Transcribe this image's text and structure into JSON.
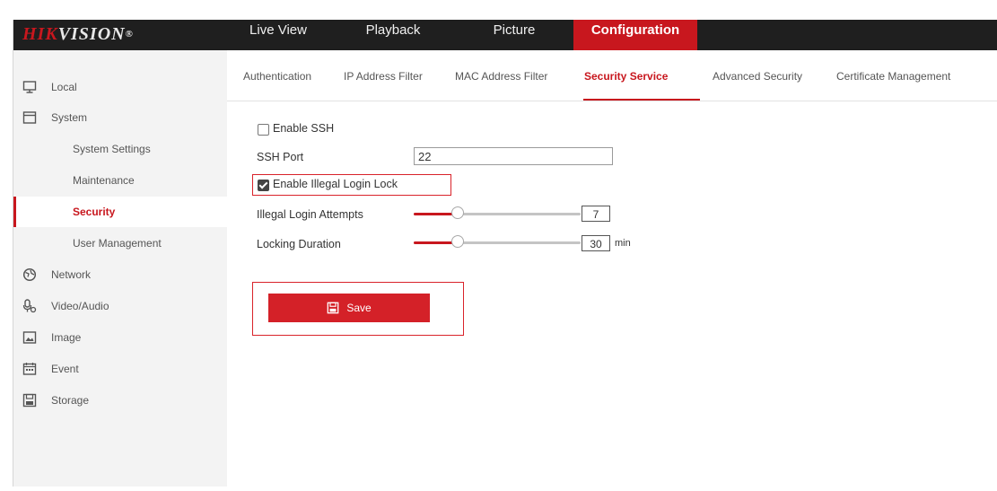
{
  "header": {
    "logo_red": "HIK",
    "logo_rest": "VISION",
    "logo_mark": "®",
    "nav": [
      {
        "label": "Live View",
        "active": false
      },
      {
        "label": "Playback",
        "active": false
      },
      {
        "label": "Picture",
        "active": false
      },
      {
        "label": "Configuration",
        "active": true
      }
    ]
  },
  "sidebar": {
    "items": [
      {
        "label": "Local",
        "icon": "monitor-icon",
        "sub": false,
        "active": false
      },
      {
        "label": "System",
        "icon": "system-icon",
        "sub": false,
        "active": false
      },
      {
        "label": "System Settings",
        "sub": true,
        "active": false
      },
      {
        "label": "Maintenance",
        "sub": true,
        "active": false
      },
      {
        "label": "Security",
        "sub": true,
        "active": true
      },
      {
        "label": "User Management",
        "sub": true,
        "active": false
      },
      {
        "label": "Network",
        "icon": "network-icon",
        "sub": false,
        "active": false
      },
      {
        "label": "Video/Audio",
        "icon": "microphone-icon",
        "sub": false,
        "active": false
      },
      {
        "label": "Image",
        "icon": "image-icon",
        "sub": false,
        "active": false
      },
      {
        "label": "Event",
        "icon": "calendar-icon",
        "sub": false,
        "active": false
      },
      {
        "label": "Storage",
        "icon": "storage-icon",
        "sub": false,
        "active": false
      }
    ]
  },
  "tabs": [
    {
      "label": "Authentication",
      "active": false
    },
    {
      "label": "IP Address Filter",
      "active": false
    },
    {
      "label": "MAC Address Filter",
      "active": false
    },
    {
      "label": "Security Service",
      "active": true
    },
    {
      "label": "Advanced Security",
      "active": false
    },
    {
      "label": "Certificate Management",
      "active": false
    }
  ],
  "form": {
    "enable_ssh_label": "Enable SSH",
    "enable_ssh_checked": false,
    "ssh_port_label": "SSH Port",
    "ssh_port_value": "22",
    "illegal_login_lock_label": "Enable Illegal Login Lock",
    "illegal_login_lock_checked": true,
    "attempts_label": "Illegal Login Attempts",
    "attempts_value": "7",
    "duration_label": "Locking Duration",
    "duration_value": "30",
    "duration_unit": "min",
    "save_label": "Save"
  },
  "colors": {
    "accent": "#c8171e",
    "topbar": "#1f1f1f",
    "sidebar_bg": "#f3f3f3"
  }
}
